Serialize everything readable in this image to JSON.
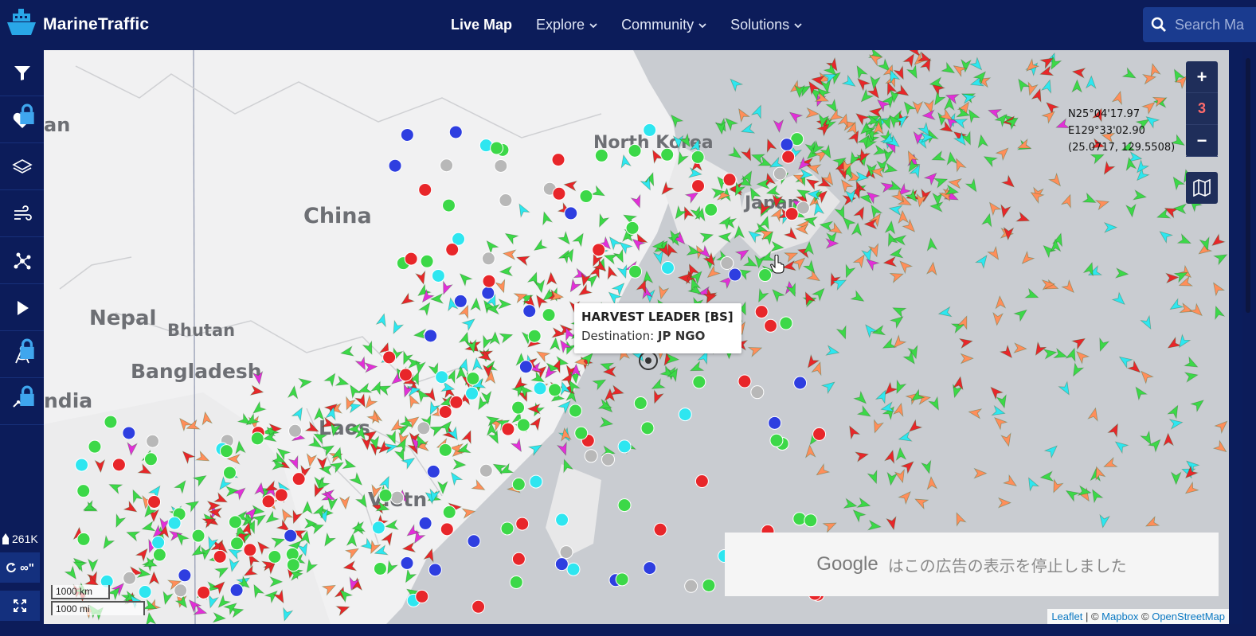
{
  "brand": {
    "name": "MarineTraffic",
    "logo_icon": "ship-logo-icon"
  },
  "nav": [
    {
      "label": "Live Map",
      "active": true,
      "dropdown": false
    },
    {
      "label": "Explore",
      "active": false,
      "dropdown": true
    },
    {
      "label": "Community",
      "active": false,
      "dropdown": true
    },
    {
      "label": "Solutions",
      "active": false,
      "dropdown": true
    }
  ],
  "search": {
    "placeholder": "Search Ma"
  },
  "sidebar": {
    "buttons": [
      {
        "icon": "filter-icon",
        "locked": false
      },
      {
        "icon": "heart-icon",
        "locked": true
      },
      {
        "icon": "layers-icon",
        "locked": false
      },
      {
        "icon": "wind-icon",
        "locked": false
      },
      {
        "icon": "network-icon",
        "locked": false
      },
      {
        "icon": "play-icon",
        "locked": false
      },
      {
        "icon": "measure-compass-icon",
        "locked": true
      },
      {
        "icon": "route-line-icon",
        "locked": true
      }
    ],
    "vessel_count": "261K",
    "refresh_label": "∞\"",
    "fullscreen_icon": "fullscreen-icon"
  },
  "map": {
    "countries": [
      {
        "label": "China"
      },
      {
        "label": "Nepal"
      },
      {
        "label": "Bhutan"
      },
      {
        "label": "Bangladesh"
      },
      {
        "label": "ndia"
      },
      {
        "label": "Laos"
      },
      {
        "label": "Vietn"
      },
      {
        "label": "North Korea"
      },
      {
        "label": "Japan"
      },
      {
        "label": "an"
      }
    ],
    "coordinates": {
      "lat": "N25°04'17.97",
      "lon": "E129°33'02.90",
      "decimal": "(25.0717, 129.5508)"
    },
    "zoom": {
      "in_label": "+",
      "level": "3",
      "out_label": "−"
    },
    "tooltip": {
      "vessel_name": "HARVEST LEADER [BS]",
      "destination_label": "Destination:",
      "destination_value": "JP NGO"
    },
    "ad": {
      "google_label": "Google",
      "text": "はこの広告の表示を停止しました"
    },
    "scale": {
      "km": "1000 km",
      "mi": "1000 mi"
    },
    "attribution": {
      "leaflet": "Leaflet",
      "sep1": " | © ",
      "mapbox": "Mapbox",
      "sep2": " © ",
      "osm": "OpenStreetMap"
    },
    "vessel_colors": {
      "cargo": "#3cd848",
      "tanker": "#e8262a",
      "passenger": "#2e3ee0",
      "fishing": "#ff8e5a",
      "tug": "#2ee6f0",
      "pleasure": "#e22fd8",
      "unknown": "#b8b8b8"
    }
  }
}
